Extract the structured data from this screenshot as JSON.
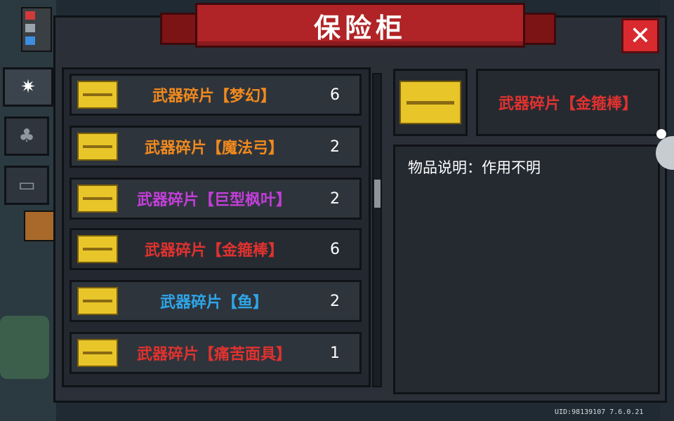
{
  "title": "保险柜",
  "close_label": "✕",
  "tabs": [
    {
      "name": "sparkle-icon",
      "glyph": "✷",
      "active": true
    },
    {
      "name": "plant-icon",
      "glyph": "♣",
      "active": false
    },
    {
      "name": "ticket-icon",
      "glyph": "▭",
      "active": false
    }
  ],
  "items": [
    {
      "name": "武器碎片【梦幻】",
      "count": "6",
      "color": "#f08a1e"
    },
    {
      "name": "武器碎片【魔法弓】",
      "count": "2",
      "color": "#f08a1e"
    },
    {
      "name": "武器碎片【巨型枫叶】",
      "count": "2",
      "color": "#c23fd8"
    },
    {
      "name": "武器碎片【金箍棒】",
      "count": "6",
      "color": "#e0322f"
    },
    {
      "name": "武器碎片【鱼】",
      "count": "2",
      "color": "#2ea6e8"
    },
    {
      "name": "武器碎片【痛苦面具】",
      "count": "1",
      "color": "#e0322f"
    }
  ],
  "selected": {
    "name": "武器碎片【金箍棒】",
    "description": "物品说明：作用不明"
  },
  "uid": "UID:98139107 7.6.0.21"
}
